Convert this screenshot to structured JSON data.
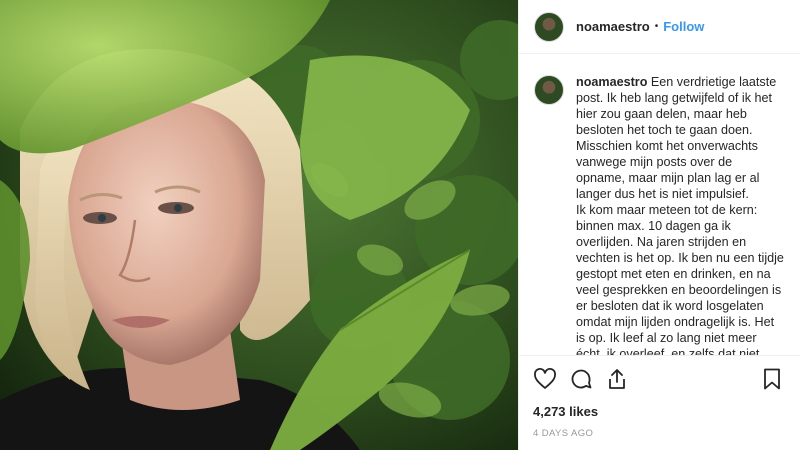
{
  "header": {
    "username": "noamaestro",
    "separator": "•",
    "follow_label": "Follow"
  },
  "post": {
    "caption_username": "noamaestro",
    "caption_text": " Een verdrietige laatste post. Ik heb lang getwijfeld of ik het hier zou gaan delen, maar heb besloten het toch te gaan doen. Misschien komt het onverwachts vanwege mijn posts over de opname, maar mijn plan lag er al langer dus het is niet impulsief.\nIk kom maar meteen tot de kern: binnen max. 10 dagen ga ik overlijden. Na jaren strijden en vechten is het op. Ik ben nu een tijdje gestopt met eten en drinken, en na veel gesprekken en beoordelingen is er besloten dat ik word losgelaten omdat mijn lijden ondragelijk is. Het is op. Ik leef al zo lang niet meer écht, ik overleef, en zelfs dat niet echt. Ik",
    "likes": "4,273 likes",
    "time_ago": "4 DAYS AGO"
  },
  "icons": {
    "like": "heart-icon",
    "comment": "comment-icon",
    "share": "share-icon",
    "save": "bookmark-icon"
  },
  "colors": {
    "accent": "#3897f0",
    "text": "#262626",
    "muted": "#999999",
    "divider": "#efefef"
  }
}
